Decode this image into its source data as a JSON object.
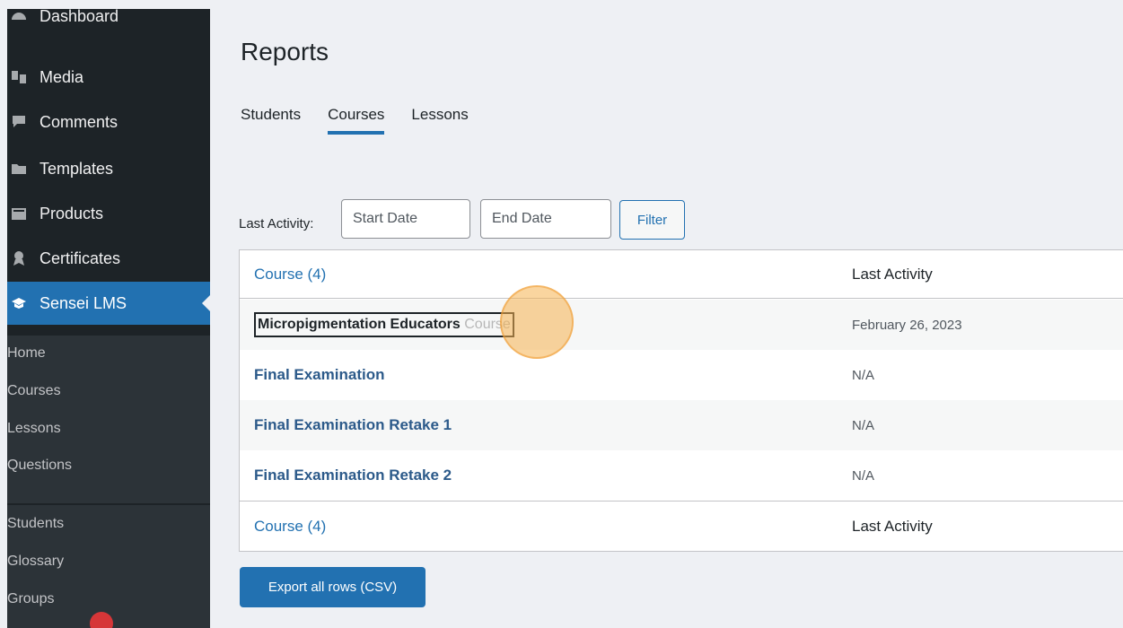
{
  "sidebar": {
    "items": [
      {
        "label": "Dashboard",
        "icon": "dashboard-icon"
      },
      {
        "label": "Media",
        "icon": "media-icon"
      },
      {
        "label": "Comments",
        "icon": "comments-icon"
      },
      {
        "label": "Templates",
        "icon": "folder-icon"
      },
      {
        "label": "Products",
        "icon": "products-icon"
      },
      {
        "label": "Certificates",
        "icon": "certificate-icon"
      },
      {
        "label": "Sensei LMS",
        "icon": "graduation-cap-icon",
        "active": true
      }
    ],
    "submenu": [
      "Home",
      "Courses",
      "Lessons",
      "Questions",
      "Students",
      "Glossary",
      "Groups"
    ]
  },
  "page": {
    "title": "Reports"
  },
  "tabs": [
    {
      "label": "Students"
    },
    {
      "label": "Courses",
      "active": true
    },
    {
      "label": "Lessons"
    }
  ],
  "filter": {
    "label": "Last Activity:",
    "start_placeholder": "Start Date",
    "end_placeholder": "End Date",
    "button": "Filter"
  },
  "table": {
    "header": {
      "course": "Course (4)",
      "activity": "Last Activity"
    },
    "rows": [
      {
        "course_main": "Micropigmentation Educators",
        "course_fade": " Course",
        "activity": "February 26, 2023"
      },
      {
        "course": "Final Examination",
        "activity": "N/A"
      },
      {
        "course": "Final Examination Retake 1",
        "activity": "N/A"
      },
      {
        "course": "Final Examination Retake 2",
        "activity": "N/A"
      }
    ],
    "footer": {
      "course": "Course (4)",
      "activity": "Last Activity"
    }
  },
  "export_button": "Export all rows (CSV)",
  "colors": {
    "accent": "#2271b1",
    "sidebar": "#1d2327",
    "highlight": "#f6b250"
  }
}
